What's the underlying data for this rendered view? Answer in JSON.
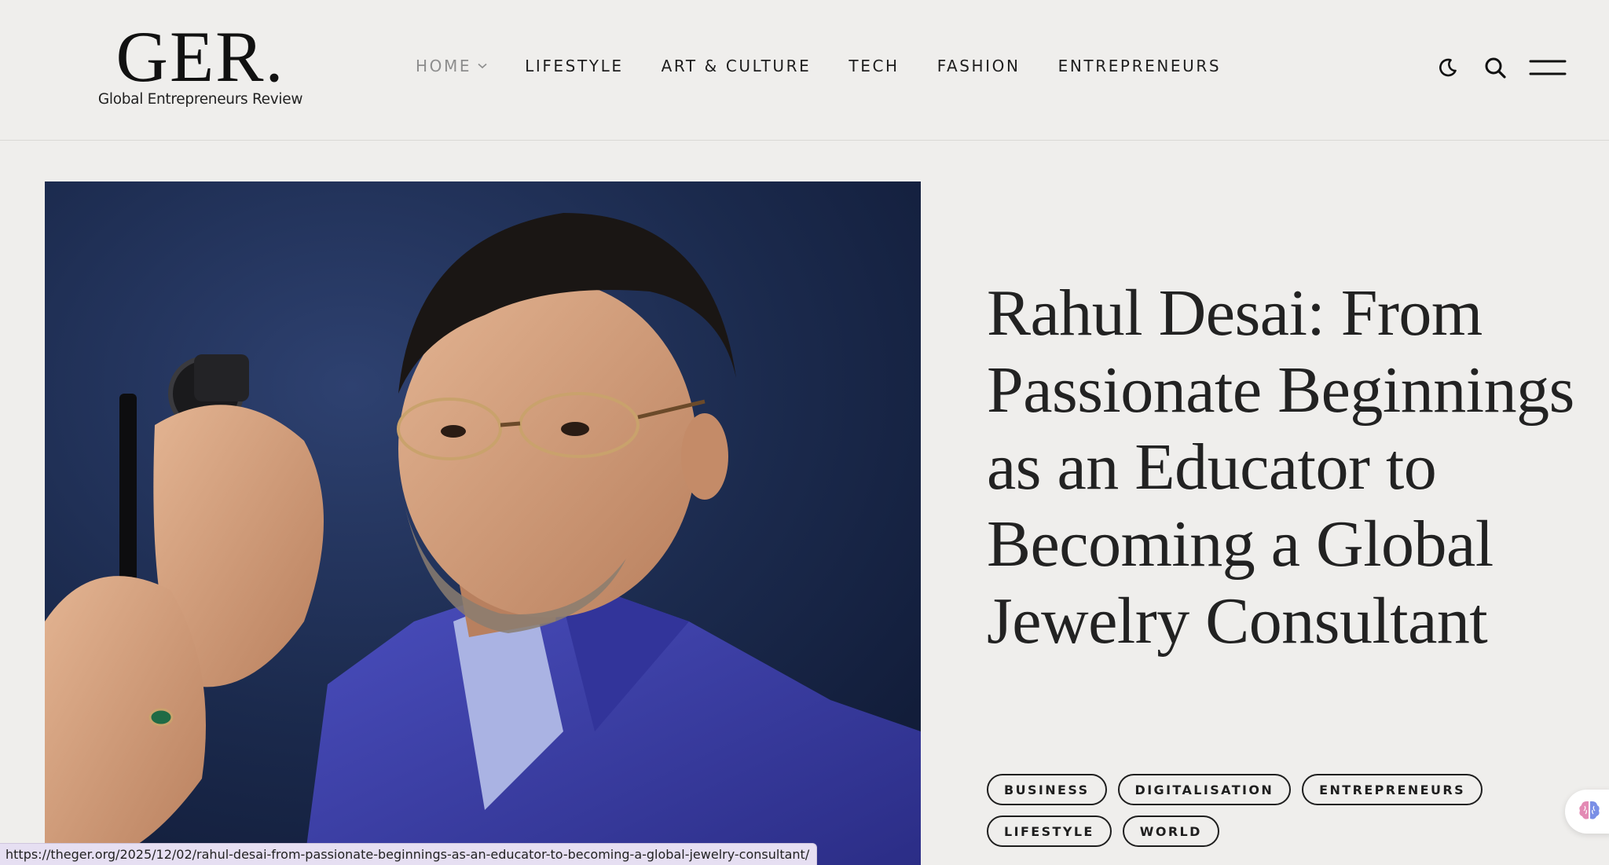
{
  "logo": {
    "mark": "GER.",
    "tagline": "Global Entrepreneurs Review"
  },
  "nav": {
    "items": [
      {
        "label": "HOME",
        "active": true,
        "has_dropdown": true
      },
      {
        "label": "LIFESTYLE"
      },
      {
        "label": "ART & CULTURE"
      },
      {
        "label": "TECH"
      },
      {
        "label": "FASHION"
      },
      {
        "label": "ENTREPRENEURS"
      }
    ]
  },
  "header_icons": [
    "dark-mode-moon-icon",
    "search-icon",
    "hamburger-menu-icon"
  ],
  "article": {
    "title": "Rahul Desai: From Passionate Beginnings as an Educator to Becoming a Global Jewelry Consultant",
    "tags": [
      "BUSINESS",
      "DIGITALISATION",
      "ENTREPRENEURS",
      "LIFESTYLE",
      "WORLD"
    ]
  },
  "status_bar": {
    "url": "https://theger.org/2025/12/02/rahul-desai-from-passionate-beginnings-as-an-educator-to-becoming-a-global-jewelry-consultant/"
  },
  "colors": {
    "background": "#efeeec",
    "text": "#1e1e1e",
    "nav_active": "#8d8d8d",
    "hero_bg": "#1c2a4e",
    "suit_blue": "#3b3d9e",
    "status_bg": "#e6dff2"
  }
}
